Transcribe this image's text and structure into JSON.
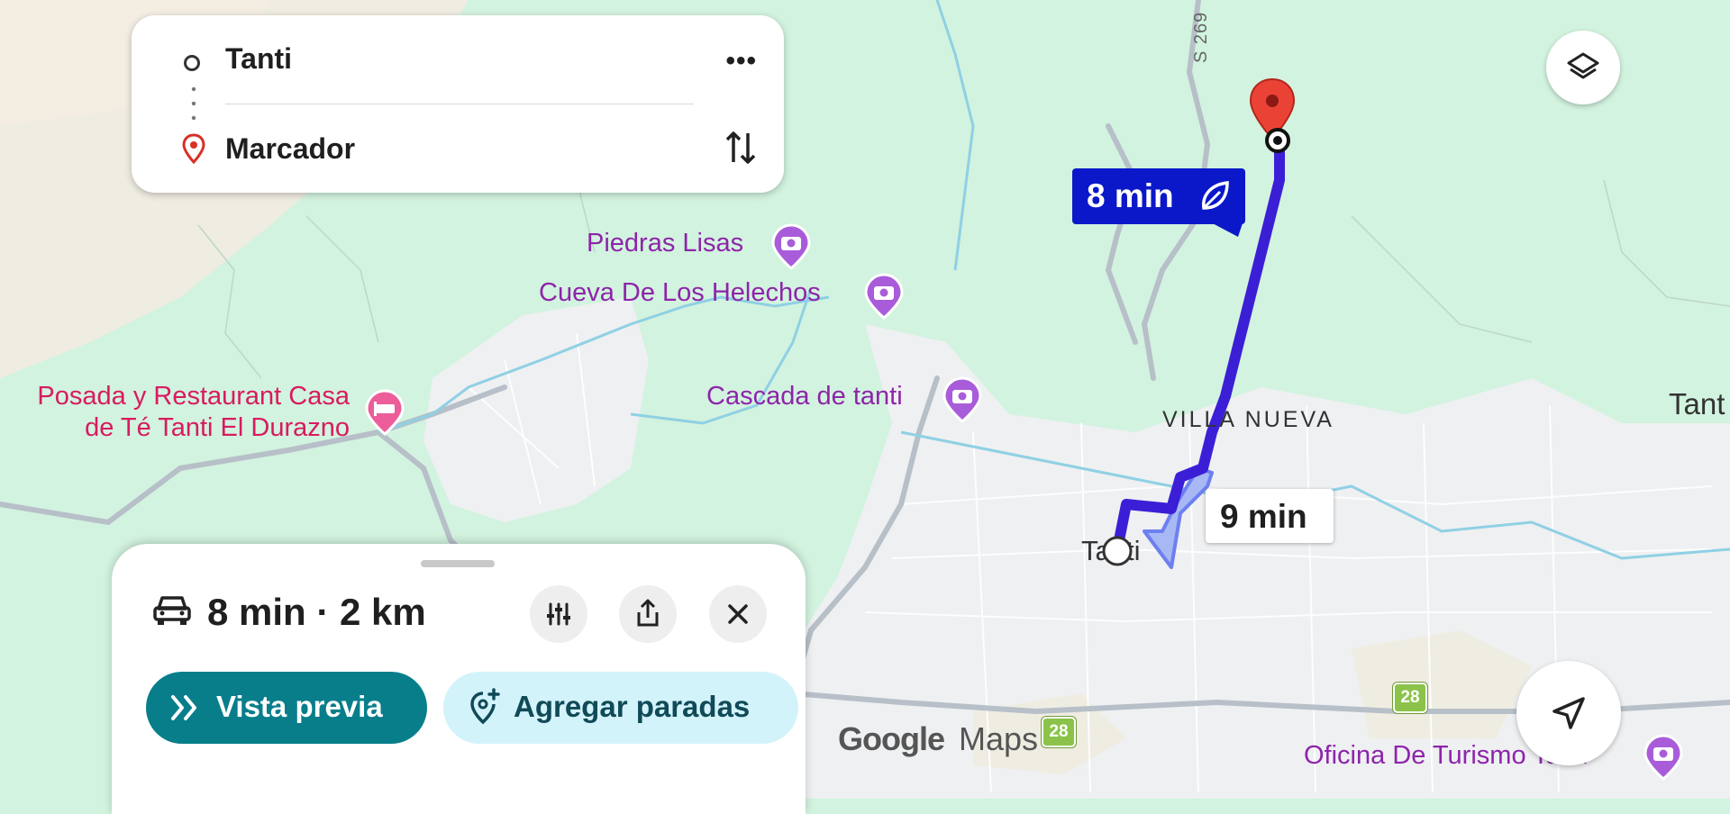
{
  "route_card": {
    "origin": "Tanti",
    "destination": "Marcador",
    "more_label": "•••"
  },
  "map": {
    "pois": {
      "piedras_lisas": "Piedras Lisas",
      "cueva": "Cueva De Los Helechos",
      "cascada": "Cascada de tanti",
      "posada_line1": "Posada y Restaurant Casa",
      "posada_line2": "de Té Tanti El Durazno",
      "oficina": "Oficina De Turismo Tanti"
    },
    "labels": {
      "villa_nueva": "VILLA NUEVA",
      "tanti_town": "Tanti",
      "tanti_edge": "Tant",
      "road_s269": "S 269",
      "road_28": "28"
    },
    "route_time_primary": "8 min",
    "route_time_alt": "9 min",
    "logo_google": "Google",
    "logo_maps": "Maps",
    "colors": {
      "route": "#3b1fd6",
      "route_chip": "#0b18c9",
      "poi": "#8e24aa",
      "preview_button": "#087e8b"
    }
  },
  "sheet": {
    "summary": "8 min · 2 km",
    "preview_button": "Vista previa",
    "add_stops_button": "Agregar paradas"
  },
  "icons": {
    "layers": "layers-icon",
    "navigate": "navigation-arrow-icon",
    "car": "car-icon",
    "tune": "tune-icon",
    "share": "share-icon",
    "close": "close-icon",
    "swap": "swap-icon",
    "pin": "location-pin-icon",
    "camera": "camera-icon",
    "hotel": "hotel-icon",
    "leaf": "leaf-icon"
  }
}
